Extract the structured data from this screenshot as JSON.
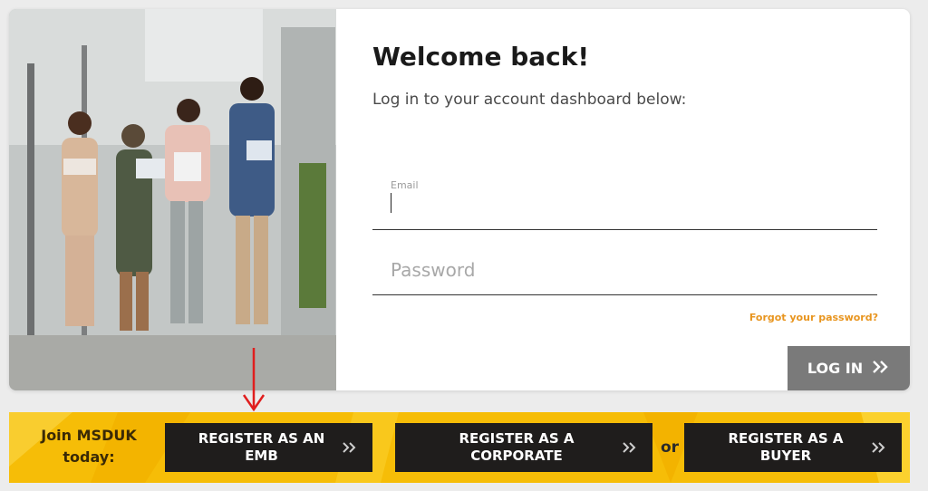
{
  "login": {
    "title": "Welcome back!",
    "subtitle": "Log in to your account dashboard below:",
    "email_label": "Email",
    "email_value": "",
    "password_placeholder": "Password",
    "forgot_link": "Forgot your password?",
    "login_button": "LOG IN"
  },
  "banner": {
    "join_line1": "Join MSDUK",
    "join_line2": "today:",
    "register_emb": [
      "REGISTER AS AN",
      "EMB"
    ],
    "register_corporate": [
      "REGISTER AS A",
      "CORPORATE"
    ],
    "or_text": "or",
    "register_buyer": [
      "REGISTER AS A",
      "BUYER"
    ]
  },
  "colors": {
    "accent_orange": "#e8951f",
    "banner_yellow": "#f6bd07",
    "button_dark": "#1f1d1c",
    "login_grey": "#7a7a7a",
    "annotation_red": "#e01e1e"
  },
  "icons": {
    "login_chevron": "double-chevron-right-icon",
    "register_chevron": "double-chevron-right-icon",
    "annotation": "red-arrow-down-icon"
  }
}
